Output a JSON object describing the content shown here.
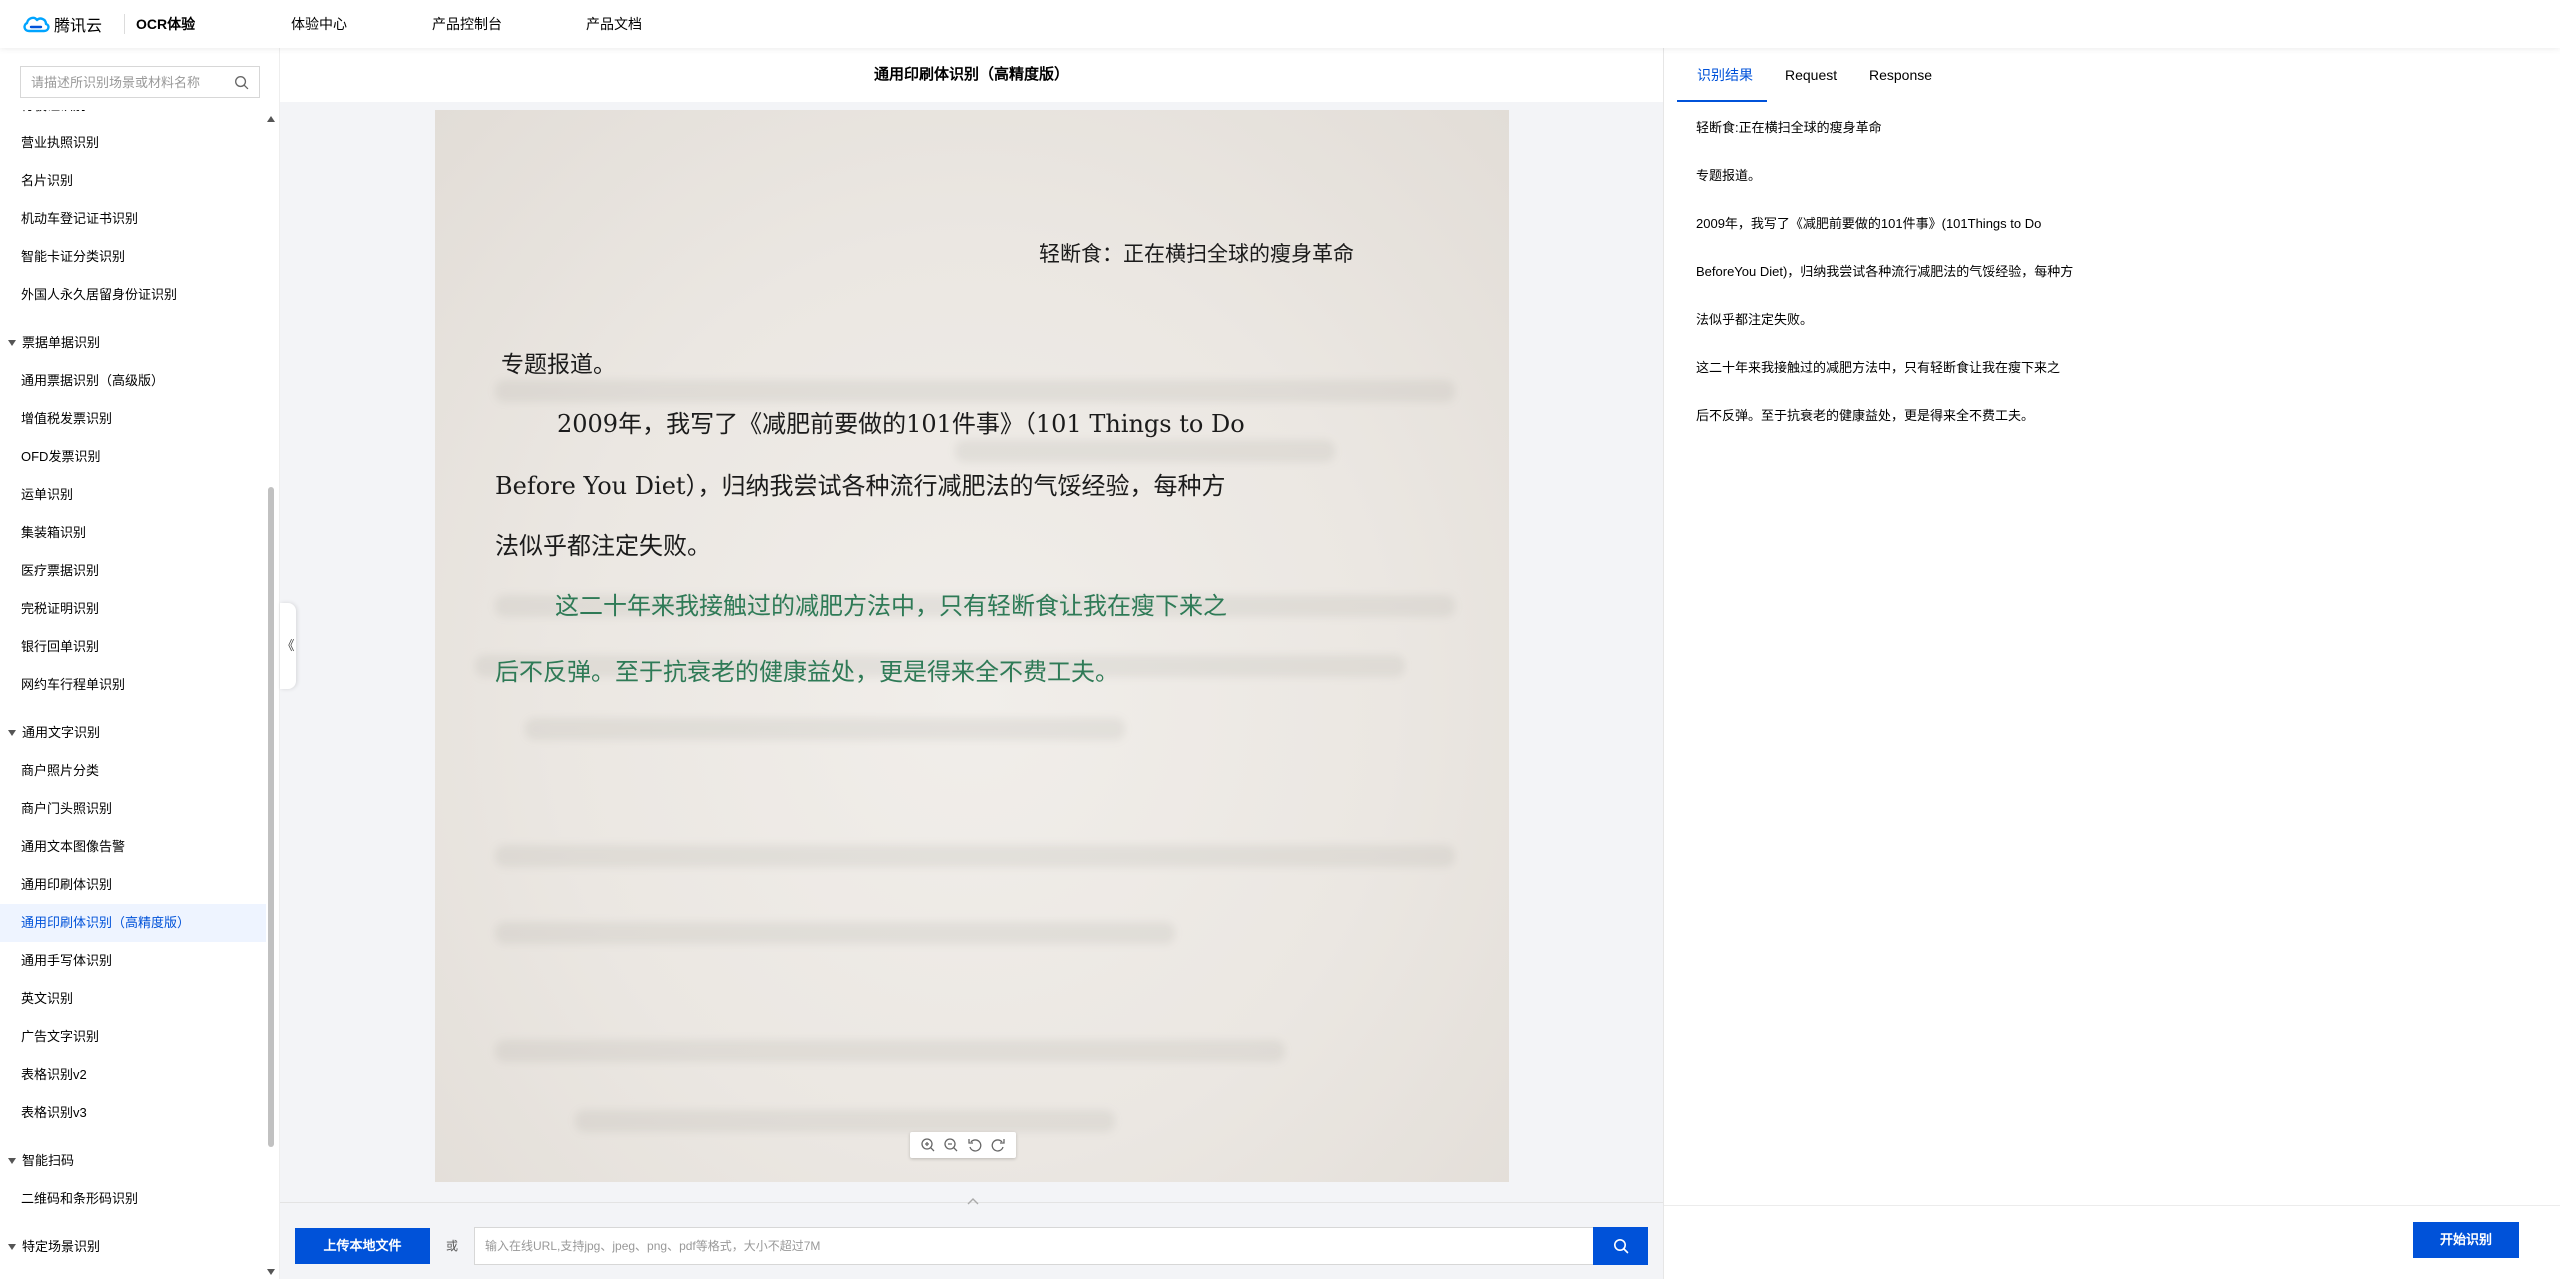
{
  "topbar": {
    "logo_text": "腾讯云",
    "nav": [
      "OCR体验",
      "体验中心",
      "产品控制台",
      "产品文档"
    ]
  },
  "sidebar": {
    "search_placeholder": "请描述所识别场景或材料名称",
    "partial_top_item": "行驶证识别",
    "group_items_1": [
      "营业执照识别",
      "名片识别",
      "机动车登记证书识别",
      "智能卡证分类识别",
      "外国人永久居留身份证识别"
    ],
    "group_2": "票据单据识别",
    "group_items_2": [
      "通用票据识别（高级版）",
      "增值税发票识别",
      "OFD发票识别",
      "运单识别",
      "集装箱识别",
      "医疗票据识别",
      "完税证明识别",
      "银行回单识别",
      "网约车行程单识别"
    ],
    "group_3": "通用文字识别",
    "group_items_3": [
      "商户照片分类",
      "商户门头照识别",
      "通用文本图像告警",
      "通用印刷体识别",
      "通用印刷体识别（高精度版）",
      "通用手写体识别",
      "英文识别",
      "广告文字识别",
      "表格识别v2",
      "表格识别v3"
    ],
    "group_4": "智能扫码",
    "group_items_4": [
      "二维码和条形码识别"
    ],
    "group_5": "特定场景识别"
  },
  "middle": {
    "title": "通用印刷体识别（高精度版）",
    "collapse_glyph": "《",
    "photo": {
      "header": "轻断食：正在横扫全球的瘦身革命",
      "line1": "专题报道。",
      "line2": "2009年，我写了《减肥前要做的101件事》（101 Things to Do",
      "line3": "Before You Diet），归纳我尝试各种流行减肥法的气馁经验，每种方",
      "line4": "法似乎都注定失败。",
      "line5": "这二十年来我接触过的减肥方法中，只有轻断食让我在瘦下来之",
      "line6": "后不反弹。至于抗衰老的健康益处，更是得来全不费工夫。"
    },
    "upload_label": "上传本地文件",
    "or_label": "或",
    "url_placeholder": "输入在线URL,支持jpg、jpeg、png、pdf等格式，大小不超过7M"
  },
  "right": {
    "tabs": [
      "识别结果",
      "Request",
      "Response"
    ],
    "results": [
      "轻断食:正在横扫全球的瘦身革命",
      "专题报道。",
      "2009年，我写了《减肥前要做的101件事》(101Things to Do",
      "BeforeYou Diet)，归纳我尝试各种流行减肥法的气馁经验，每种方",
      "法似乎都注定失败。",
      "这二十年来我接触过的减肥方法中，只有轻断食让我在瘦下来之",
      "后不反弹。至于抗衰老的健康益处，更是得来全不费工夫。"
    ],
    "start_label": "开始识别"
  },
  "colors": {
    "accent": "#0052d9",
    "active_bg": "#eef4ff",
    "green_text": "#2e7a56"
  },
  "icons": [
    "tencent-cloud-logo-icon",
    "search-icon",
    "zoom-in-icon",
    "zoom-out-icon",
    "rotate-left-icon",
    "rotate-right-icon",
    "drag-handle-icon"
  ]
}
